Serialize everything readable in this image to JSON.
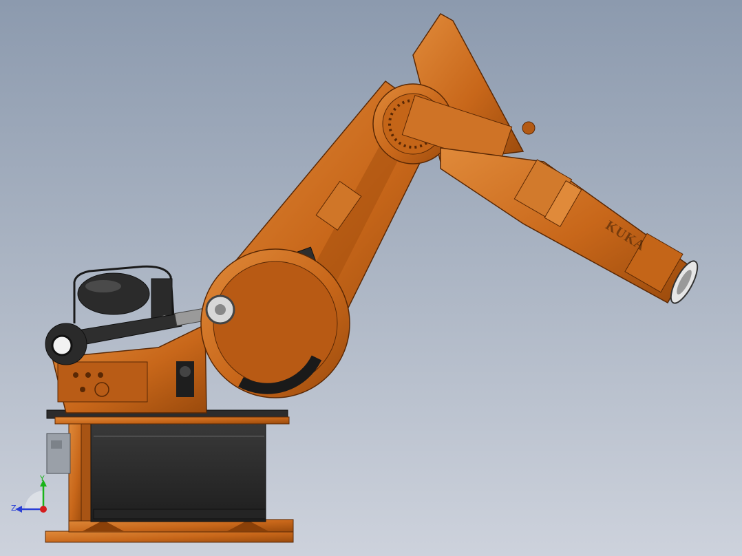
{
  "scene": {
    "model_label": "KUKA",
    "colors": {
      "robot_orange": "#c8671a",
      "robot_dark": "#6e3206",
      "robot_light": "#e69a4c",
      "base_black": "#2b2b2b",
      "background_top": "#8c9aae",
      "background_bottom": "#cdd2dc"
    }
  },
  "triad": {
    "y_label": "Y",
    "z_label": "Z",
    "colors": {
      "y": "#19b319",
      "z": "#2a3fd6",
      "x": "#d41c1c"
    }
  }
}
